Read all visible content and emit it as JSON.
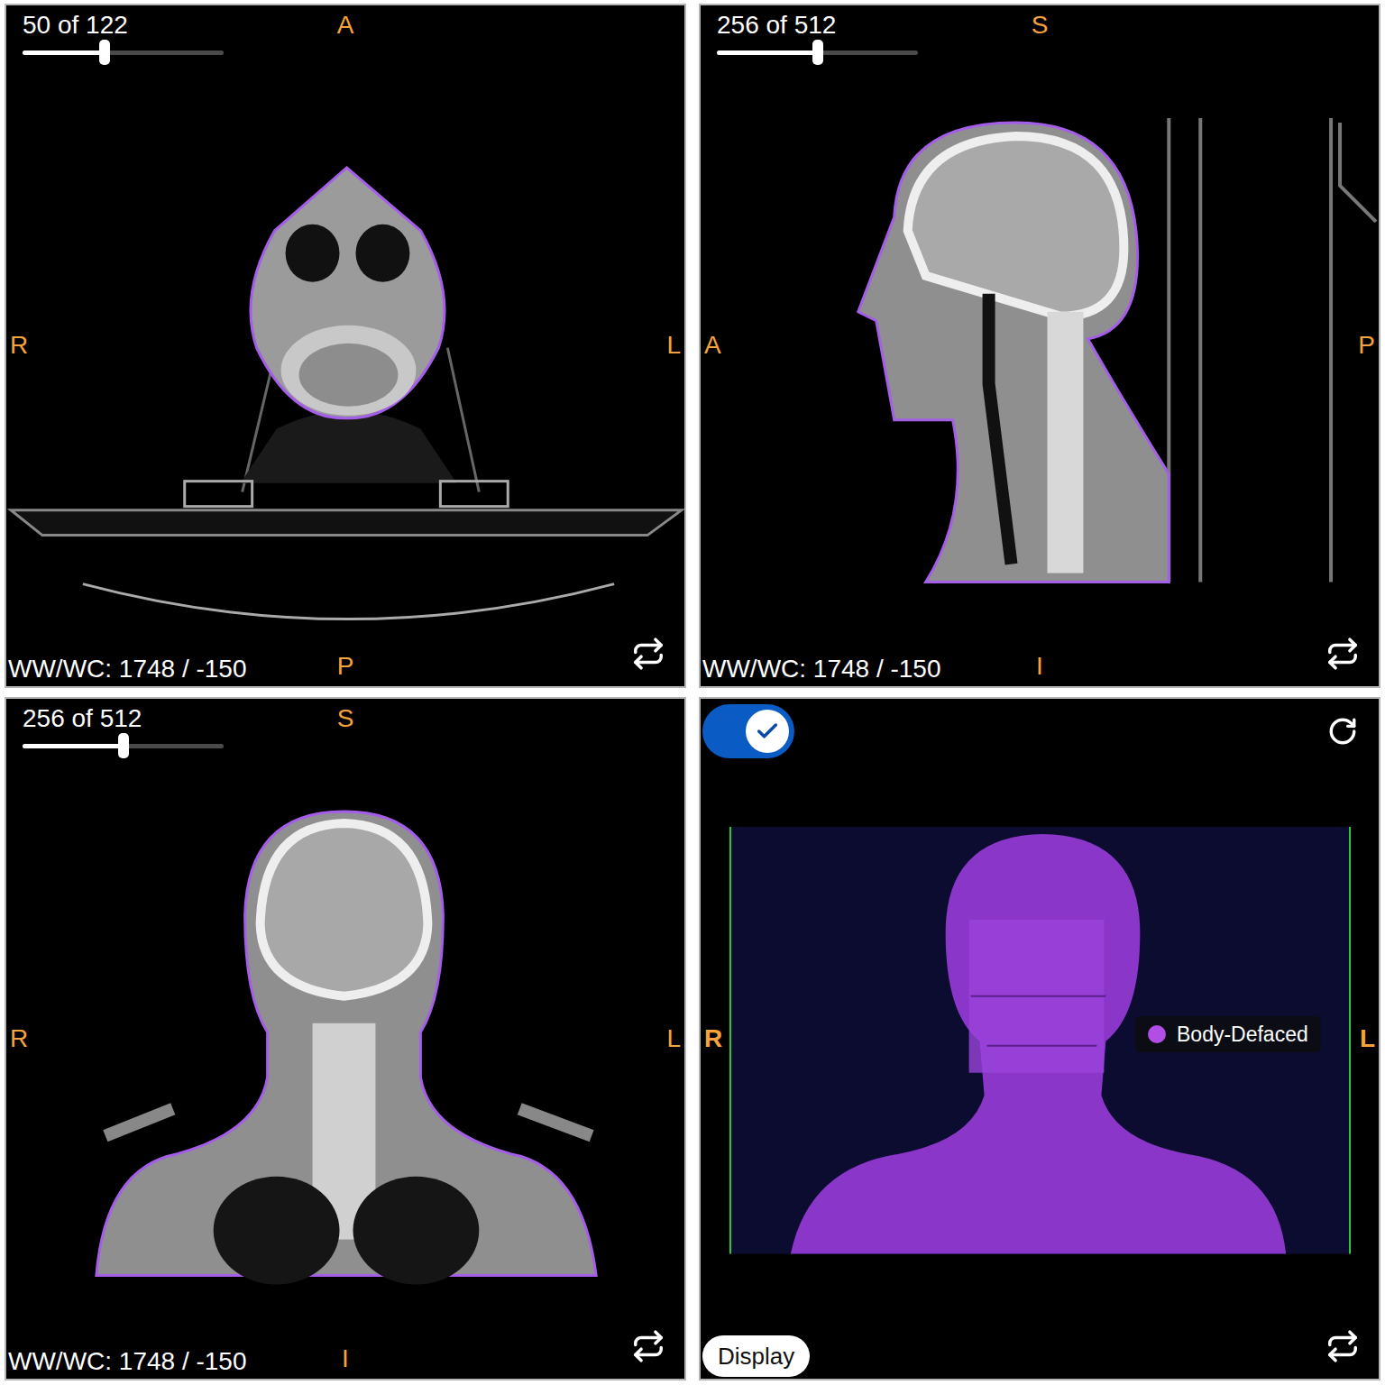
{
  "viewports": [
    {
      "kind": "axial",
      "slice": "50 of 122",
      "level": 0.41,
      "top": "A",
      "bottom": "P",
      "left": "R",
      "right": "L",
      "window": "WW/WC: 1748 / -150"
    },
    {
      "kind": "sagittal",
      "slice": "256 of 512",
      "level": 0.5,
      "top": "S",
      "bottom": "I",
      "left": "A",
      "right": "P",
      "window": "WW/WC: 1748 / -150"
    },
    {
      "kind": "coronal",
      "slice": "256 of 512",
      "level": 0.5,
      "top": "S",
      "bottom": "I",
      "left": "R",
      "right": "L",
      "window": "WW/WC: 1748 / -150"
    }
  ],
  "view3d": {
    "toggle_on": true,
    "left": "R",
    "right": "L",
    "legend": [
      {
        "label": "Body-Defaced",
        "color": "#b04ee6"
      }
    ],
    "button": "Display"
  }
}
